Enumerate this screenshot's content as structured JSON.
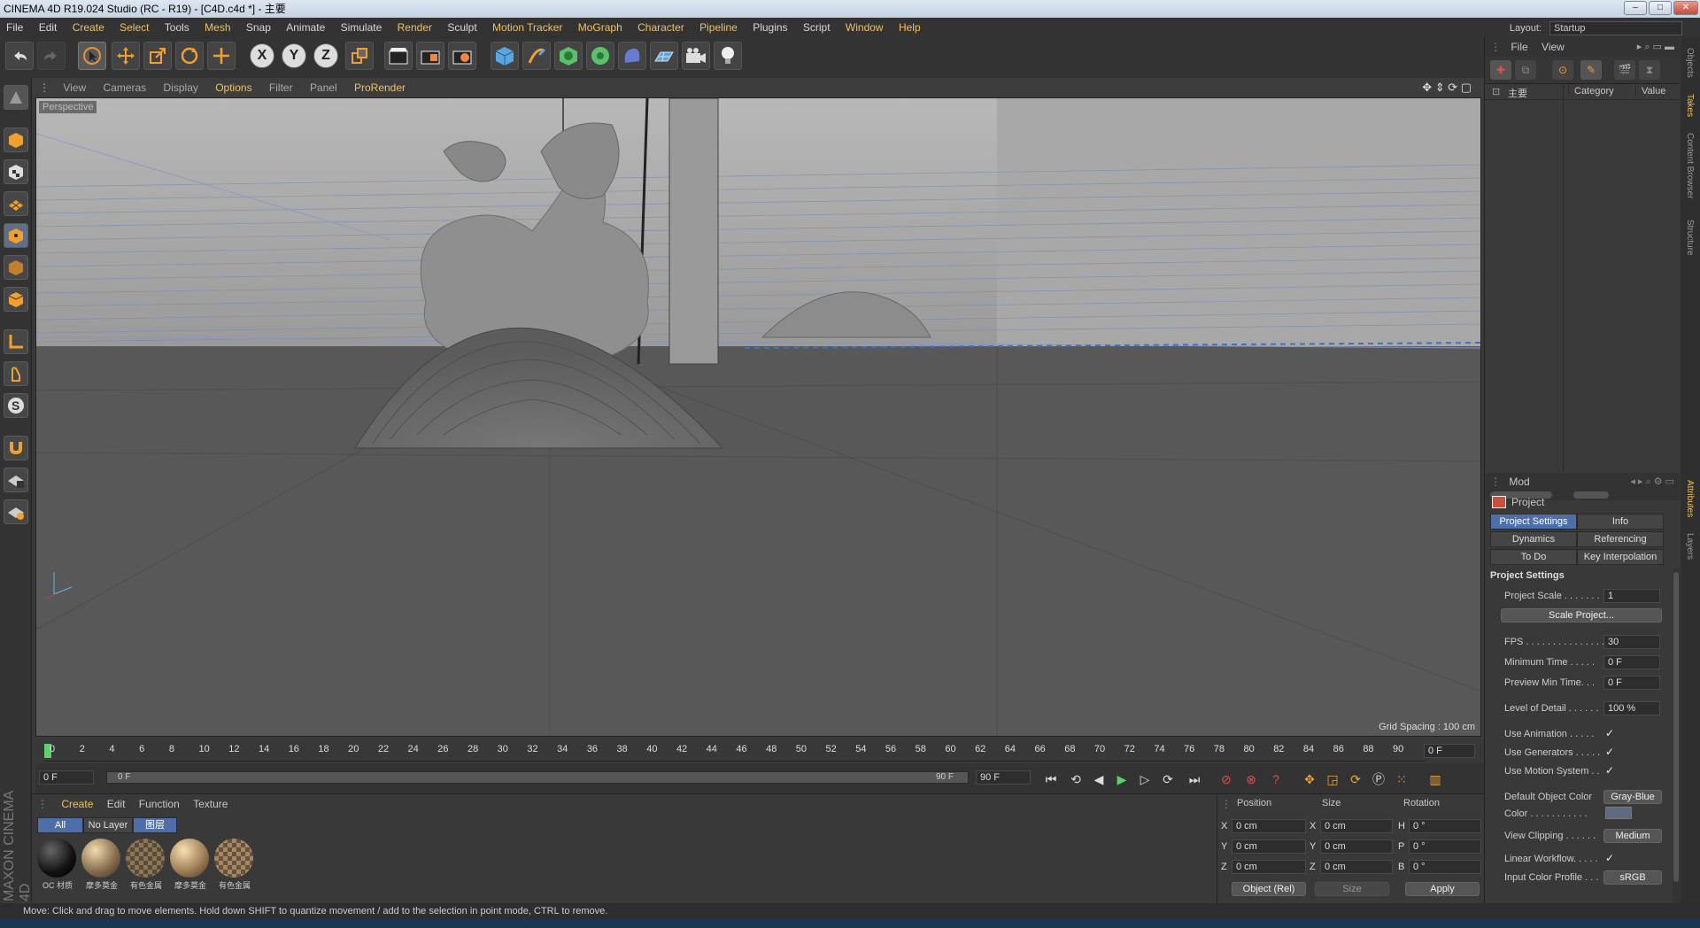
{
  "title": "CINEMA 4D R19.024 Studio (RC - R19) - [C4D.c4d *] - 主要",
  "menu": [
    "File",
    "Edit",
    "Create",
    "Select",
    "Tools",
    "Mesh",
    "Snap",
    "Animate",
    "Simulate",
    "Render",
    "Sculpt",
    "Motion Tracker",
    "MoGraph",
    "Character",
    "Pipeline",
    "Plugins",
    "Script",
    "Window",
    "Help"
  ],
  "layout_label": "Layout:",
  "layout_value": "Startup",
  "viewport_menu": [
    "View",
    "Cameras",
    "Display",
    "Options",
    "Filter",
    "Panel",
    "ProRender"
  ],
  "viewport_label": "Perspective",
  "grid_spacing": "Grid Spacing : 100 cm",
  "timeline": {
    "ticks": [
      "0",
      "2",
      "4",
      "6",
      "8",
      "10",
      "12",
      "14",
      "16",
      "18",
      "20",
      "22",
      "24",
      "26",
      "28",
      "30",
      "32",
      "34",
      "36",
      "38",
      "40",
      "42",
      "44",
      "46",
      "48",
      "50",
      "52",
      "54",
      "56",
      "58",
      "60",
      "62",
      "64",
      "66",
      "68",
      "70",
      "72",
      "74",
      "76",
      "78",
      "80",
      "82",
      "84",
      "86",
      "88",
      "90"
    ],
    "current_frame": "0 F",
    "start": "0 F",
    "range_start": "0 F",
    "range_end": "90 F",
    "end": "90 F"
  },
  "material_manager": {
    "menu": [
      "Create",
      "Edit",
      "Function",
      "Texture"
    ],
    "filters": [
      "All",
      "No Layer",
      "图层"
    ],
    "materials": [
      {
        "label": "OC 材质",
        "color": "#1a1a1a"
      },
      {
        "label": "摩多莫金",
        "color": "#8a7050"
      },
      {
        "label": "有色金属",
        "color": "#6a5a48"
      },
      {
        "label": "摩多莫金",
        "color": "#a08058"
      },
      {
        "label": "有色金属",
        "color": "#7a6248"
      }
    ]
  },
  "coords": {
    "headers": [
      "Position",
      "Size",
      "Rotation"
    ],
    "rows": [
      {
        "axis": "X",
        "pos": "0 cm",
        "saxis": "X",
        "size": "0 cm",
        "raxis": "H",
        "rot": "0 °"
      },
      {
        "axis": "Y",
        "pos": "0 cm",
        "saxis": "Y",
        "size": "0 cm",
        "raxis": "P",
        "rot": "0 °"
      },
      {
        "axis": "Z",
        "pos": "0 cm",
        "saxis": "Z",
        "size": "0 cm",
        "raxis": "B",
        "rot": "0 °"
      }
    ],
    "mode": "Object (Rel)",
    "size_mode": "Size",
    "apply": "Apply"
  },
  "objects_panel": {
    "menu": [
      "File",
      "View"
    ],
    "tree_root": "主要",
    "columns": [
      "Category",
      "Value"
    ]
  },
  "attributes": {
    "mode": "Mod",
    "header": "Project",
    "tabs": [
      "Project Settings",
      "Info",
      "Dynamics",
      "Referencing",
      "To Do",
      "Key Interpolation"
    ],
    "section": "Project Settings",
    "project_scale_label": "Project Scale . . . . . . .",
    "project_scale": "1",
    "scale_button": "Scale Project...",
    "fps_label": "FPS . . . . . . . . . . . . . . .",
    "fps": "30",
    "min_time_label": "Minimum Time . . . . .",
    "min_time": "0 F",
    "preview_min_label": "Preview Min Time. . .",
    "preview_min": "0 F",
    "lod_label": "Level of Detail . . . . . .",
    "lod": "100 %",
    "use_anim_label": "Use Animation . . . . .",
    "use_gen_label": "Use Generators . . . . .",
    "use_motion_label": "Use Motion System . .",
    "def_color_label": "Default Object Color",
    "def_color": "Gray-Blue",
    "color_label": "Color . . . . . . . . . . .",
    "view_clip_label": "View Clipping . . . . . .",
    "view_clip": "Medium",
    "linear_label": "Linear Workflow. . . . .",
    "input_profile_label": "Input Color Profile . . .",
    "input_profile": "sRGB",
    "checkmark": "✓"
  },
  "side_tabs": [
    "Objects",
    "Takes",
    "Content Browser",
    "Structure"
  ],
  "side_tabs_lower": [
    "Attributes",
    "Layers"
  ],
  "status": "Move: Click and drag to move elements. Hold down SHIFT to quantize movement / add to the selection in point mode, CTRL to remove.",
  "brand": "MAXON CINEMA 4D"
}
